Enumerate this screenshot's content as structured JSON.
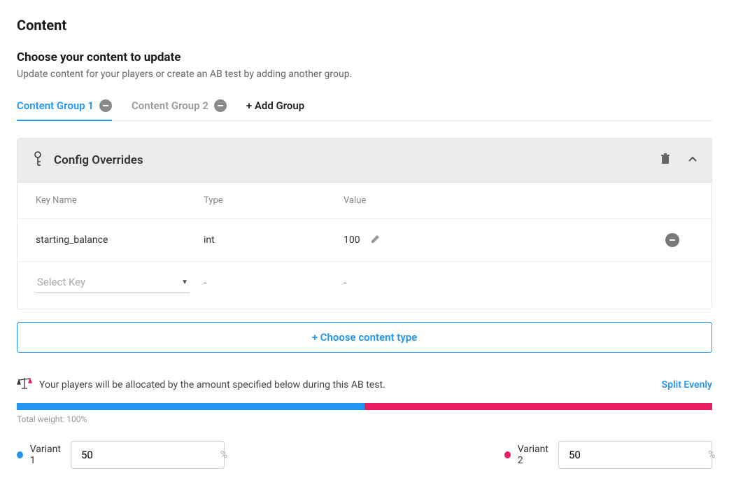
{
  "pageTitle": "Content",
  "section": {
    "title": "Choose your content to update",
    "description": "Update content for your players or create an AB test by adding another group."
  },
  "tabs": {
    "items": [
      {
        "label": "Content Group 1",
        "active": true
      },
      {
        "label": "Content Group 2",
        "active": false
      }
    ],
    "addLabel": "+ Add Group"
  },
  "overrides": {
    "title": "Config Overrides",
    "columns": {
      "key": "Key Name",
      "type": "Type",
      "value": "Value"
    },
    "rows": [
      {
        "key": "starting_balance",
        "type": "int",
        "value": "100"
      }
    ],
    "selectPlaceholder": "Select Key",
    "dash": "-"
  },
  "chooseContent": "+ Choose content type",
  "allocation": {
    "text": "Your players will be allocated by the amount specified below during this AB test.",
    "splitLabel": "Split Evenly",
    "totalWeight": "Total weight: 100%",
    "variants": [
      {
        "label": "Variant 1",
        "value": "50",
        "color": "#2196f3"
      },
      {
        "label": "Variant 2",
        "value": "50",
        "color": "#e91e63"
      }
    ],
    "percentSymbol": "%"
  }
}
